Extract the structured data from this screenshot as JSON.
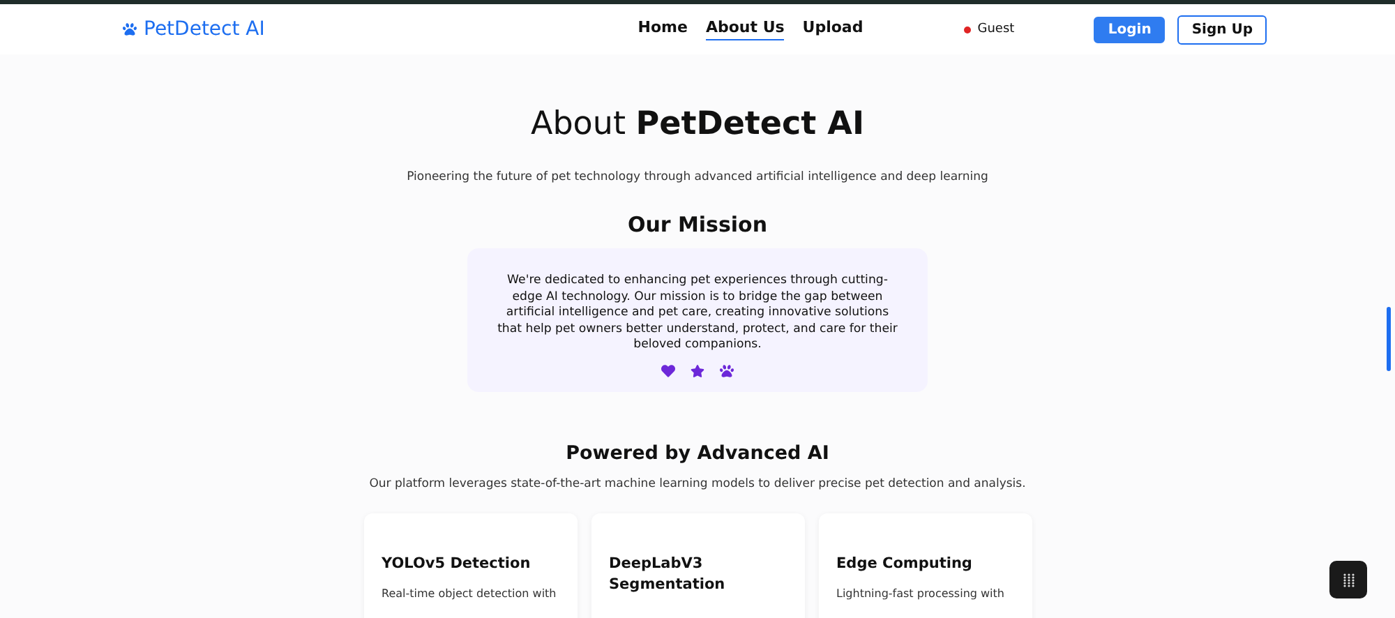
{
  "brand": "PetDetect AI",
  "nav": [
    {
      "label": "Home",
      "selected": false
    },
    {
      "label": "About Us",
      "selected": true
    },
    {
      "label": "Upload",
      "selected": false
    }
  ],
  "user": {
    "label": "Guest",
    "color": "#e02424"
  },
  "buttons": [
    {
      "label": "Login",
      "kind": "primary"
    },
    {
      "label": "Sign Up",
      "kind": "outline"
    }
  ],
  "hero": {
    "title": "About **PetDetect AI**",
    "subtitle": "Pioneering the future of pet technology through advanced artificial intelligence and deep learning"
  },
  "mission": {
    "heading": "Our Mission",
    "text": "We're dedicated to enhancing pet experiences through cutting-edge AI technology. Our mission is to bridge the gap between artificial intelligence and pet care, creating innovative solutions that help pet owners better understand, protect, and care for their beloved companions."
  },
  "ai": {
    "heading": "Powered by Advanced AI",
    "text": "Our platform leverages state-of-the-art machine learning models to deliver precise pet detection and analysis."
  },
  "features": [
    {
      "title": "YOLOv5 Detection",
      "text": "Real-time object detection with"
    },
    {
      "title": "DeepLabV3 Segmentation"
    },
    {
      "title": "Edge Computing",
      "text": "Lightning-fast processing with"
    }
  ]
}
